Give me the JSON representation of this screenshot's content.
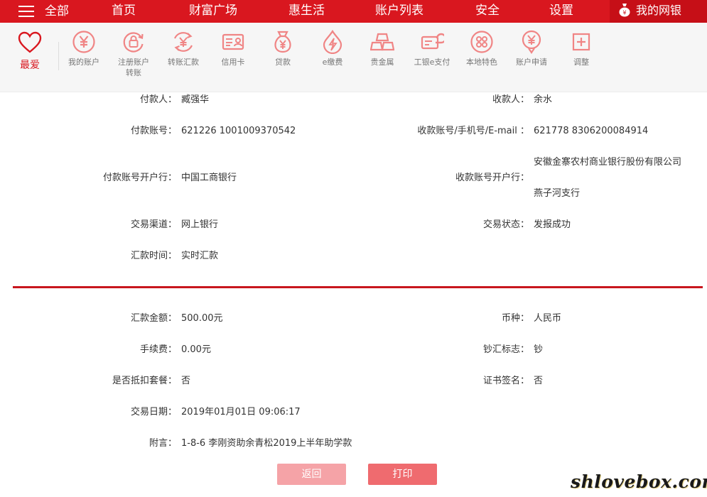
{
  "topnav": {
    "items": [
      "全部",
      "首页",
      "财富广场",
      "惠生活",
      "账户列表",
      "安全",
      "设置"
    ],
    "my_ebank": "我的网银"
  },
  "shortcuts": {
    "favorites_label": "最爱",
    "items": [
      {
        "label": "我的账户",
        "icon": "yen-circle-icon"
      },
      {
        "label": "注册账户转账",
        "line1": "注册账户",
        "line2": "转账",
        "icon": "lock-refresh-icon"
      },
      {
        "label": "转账汇款",
        "icon": "yen-transfer-icon"
      },
      {
        "label": "信用卡",
        "icon": "credit-card-icon"
      },
      {
        "label": "贷款",
        "icon": "money-bag-icon"
      },
      {
        "label": "e缴费",
        "icon": "lightning-drop-icon"
      },
      {
        "label": "贵金属",
        "icon": "gold-bars-icon"
      },
      {
        "label": "工银e支付",
        "icon": "e-pay-card-icon"
      },
      {
        "label": "本地特色",
        "icon": "dots-circle-icon"
      },
      {
        "label": "账户申请",
        "icon": "yen-pin-icon"
      },
      {
        "label": "调整",
        "icon": "plus-square-icon"
      }
    ]
  },
  "details": {
    "payer_label": "付款人：",
    "payer": "臧强华",
    "payee_label": "收款人：",
    "payee": "余水",
    "payer_account_label": "付款账号：",
    "payer_account": "621226 1001009370542",
    "payee_account_label": "收款账号/手机号/E-mail ：",
    "payee_account": "621778 8306200084914",
    "payer_bank_label": "付款账号开户行：",
    "payer_bank": "中国工商银行",
    "payee_bank_label": "收款账号开户行：",
    "payee_bank_line1": "安徽金寨农村商业银行股份有限公司",
    "payee_bank_line2": "燕子河支行",
    "channel_label": "交易渠道：",
    "channel": "网上银行",
    "status_label": "交易状态：",
    "status": "发报成功",
    "remit_time_label": "汇款时间：",
    "remit_time": "实时汇款",
    "amount_label": "汇款金额：",
    "amount": "500.00元",
    "currency_label": "币种：",
    "currency": "人民币",
    "fee_label": "手续费：",
    "fee": "0.00元",
    "cash_flag_label": "钞汇标志：",
    "cash_flag": "钞",
    "package_label": "是否抵扣套餐：",
    "package": "否",
    "cert_sign_label": "证书签名：",
    "cert_sign": "否",
    "date_label": "交易日期：",
    "date": "2019年01月01日 09:06:17",
    "memo_label": "附言：",
    "memo": "1-8-6 李刚资助余青松2019上半年助学款"
  },
  "buttons": {
    "back": "返回",
    "print": "打印"
  },
  "watermark": "shlovebox.com",
  "colors": {
    "brand_red": "#d9171f",
    "icon_pink": "#f08585",
    "back_button": "#f5a3a7",
    "print_button": "#ef6b6f"
  }
}
